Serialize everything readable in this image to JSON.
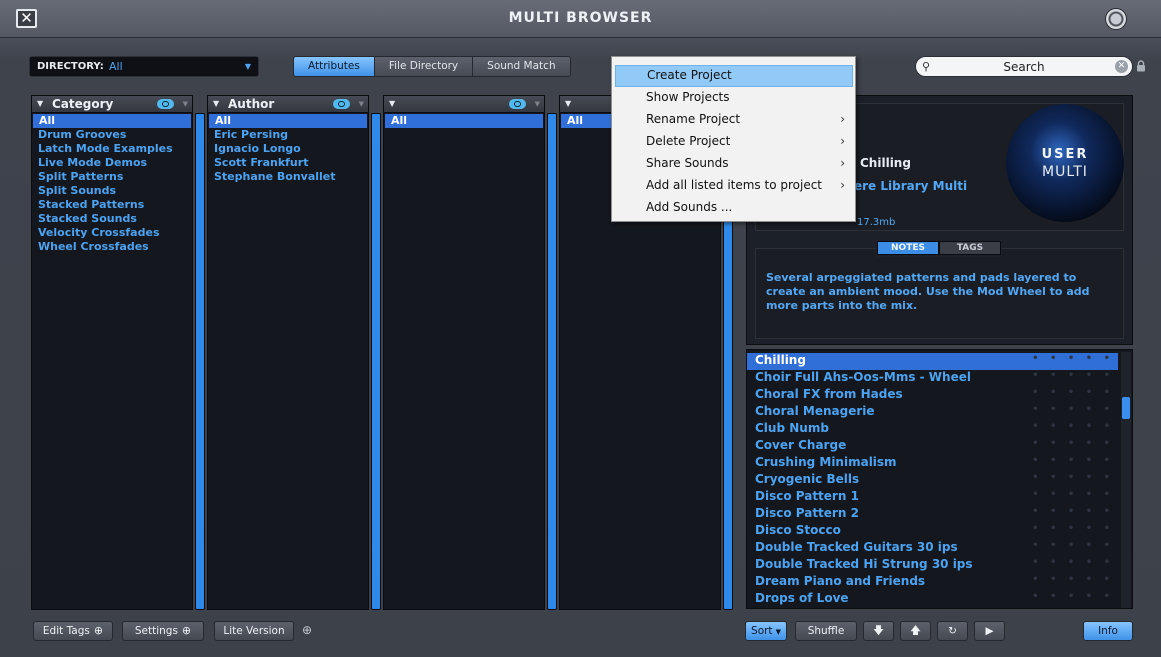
{
  "window": {
    "title": "MULTI BROWSER",
    "close_glyph": "✕"
  },
  "directory": {
    "label": "DIRECTORY:",
    "value": "All"
  },
  "tabs": [
    {
      "label": "Attributes",
      "active": true
    },
    {
      "label": "File Directory",
      "active": false
    },
    {
      "label": "Sound Match",
      "active": false
    }
  ],
  "search": {
    "placeholder": "Search"
  },
  "columns": {
    "category": {
      "title": "Category",
      "items": [
        "All",
        "Drum Grooves",
        "Latch Mode Examples",
        "Live Mode Demos",
        "Split Patterns",
        "Split Sounds",
        "Stacked Patterns",
        "Stacked Sounds",
        "Velocity Crossfades",
        "Wheel Crossfades"
      ]
    },
    "author": {
      "title": "Author",
      "items": [
        "All",
        "Eric Persing",
        "Ignacio Longo",
        "Scott Frankfurt",
        "Stephane Bonvallet"
      ]
    },
    "col3": {
      "title": "",
      "items": [
        "All"
      ]
    },
    "col4": {
      "title": "",
      "items": [
        "All"
      ]
    }
  },
  "context_menu": {
    "items": [
      {
        "label": "Create Project",
        "submenu": false,
        "highlighted": true
      },
      {
        "label": "Show Projects",
        "submenu": false
      },
      {
        "label": "Rename Project",
        "submenu": true
      },
      {
        "label": "Delete Project",
        "submenu": true
      },
      {
        "label": "Share Sounds",
        "submenu": true
      },
      {
        "label": "Add all listed items to project",
        "submenu": true
      },
      {
        "label": "Add Sounds ...",
        "submenu": false
      }
    ]
  },
  "info": {
    "preset_name": "Chilling",
    "library": "ere Library Multi",
    "size": "17.3mb",
    "badge_line1": "USER",
    "badge_line2": "MULTI",
    "notes_tab": "NOTES",
    "tags_tab": "TAGS",
    "notes": "Several arpeggiated patterns and pads layered to create an ambient mood. Use the Mod Wheel to add more parts into the mix."
  },
  "results": [
    "Chilling",
    "Choir Full Ahs-Oos-Mms - Wheel",
    "Choral FX from Hades",
    "Choral Menagerie",
    "Club Numb",
    "Cover Charge",
    "Crushing Minimalism",
    "Cryogenic Bells",
    "Disco Pattern 1",
    "Disco Pattern 2",
    "Disco Stocco",
    "Double Tracked Guitars 30 ips",
    "Double Tracked Hi Strung 30 ips",
    "Dream Piano and Friends",
    "Drops of Love"
  ],
  "footer": {
    "edit_tags": "Edit Tags",
    "settings": "Settings",
    "lite_version": "Lite Version",
    "sort": "Sort",
    "shuffle": "Shuffle",
    "info": "Info"
  },
  "colors": {
    "accent": "#3f92e8",
    "list_text": "#4ca3f2",
    "selection": "#2f6fd7"
  }
}
